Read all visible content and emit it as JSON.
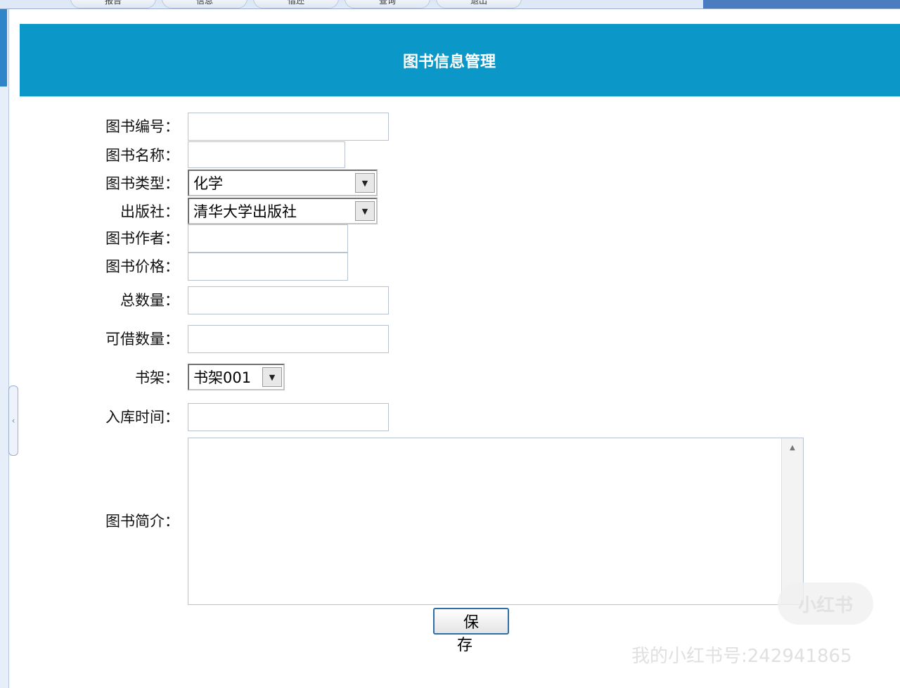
{
  "nav": {
    "tabs": [
      "报告",
      "信息",
      "借还",
      "查询",
      "退出"
    ]
  },
  "header": {
    "title": "图书信息管理"
  },
  "form": {
    "book_id": {
      "label": "图书编号：",
      "value": ""
    },
    "book_name": {
      "label": "图书名称：",
      "value": ""
    },
    "book_type": {
      "label": "图书类型：",
      "value": "化学"
    },
    "publisher": {
      "label": "出版社：",
      "value": "清华大学出版社"
    },
    "author": {
      "label": "图书作者：",
      "value": ""
    },
    "price": {
      "label": "图书价格：",
      "value": ""
    },
    "total": {
      "label": "总数量：",
      "value": ""
    },
    "available": {
      "label": "可借数量：",
      "value": ""
    },
    "shelf": {
      "label": "书架：",
      "value": "书架001"
    },
    "in_date": {
      "label": "入库时间：",
      "value": ""
    },
    "intro": {
      "label": "图书简介：",
      "value": ""
    },
    "save_label": "保存"
  },
  "watermark": {
    "logo": "小红书",
    "text": "我的小红书号:242941865"
  }
}
